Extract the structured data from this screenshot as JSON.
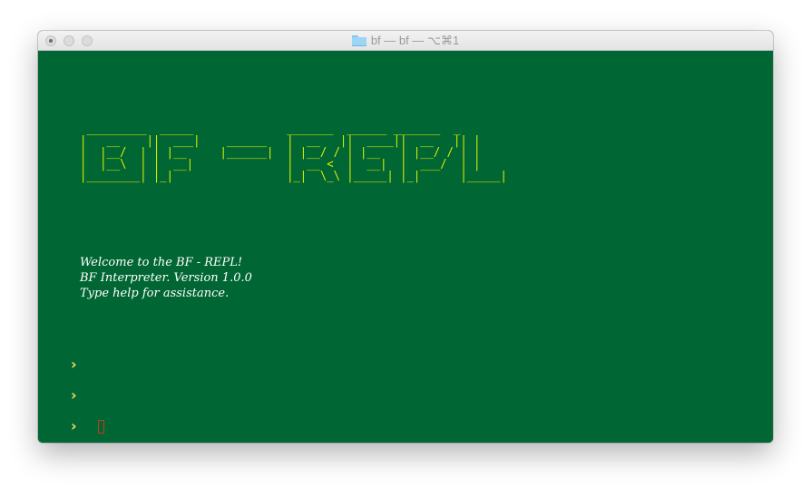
{
  "window": {
    "title": "bf — bf — ⌥⌘1",
    "title_icon": "folder-icon",
    "background_color": "#006633"
  },
  "banner": {
    "ascii_art": " _________  _____              _______  ______ _______  _\n|   __    ||  ___|    ______   |  __   ||  ____||  __   || |\n|  |__/  | | |__     |______|  | |__/ / | |__   | |__/ / | |\n|  |__\\  | |  __|              |  __ <  |  __|  |  ___/  | |\n|________| |_|                 |_|  \\_\\ |_____| |_|      |_____|",
    "text": "BF - REPL",
    "color": "#d9ef00"
  },
  "welcome": {
    "line1": "Welcome to the BF - REPL!",
    "line2": "BF Interpreter. Version 1.0.0",
    "line3": "Type help for assistance."
  },
  "prompts": [
    {
      "symbol": "›"
    },
    {
      "symbol": "›"
    },
    {
      "symbol": "›"
    }
  ],
  "colors": {
    "prompt": "#f0e060",
    "cursor": "#c83a1e",
    "text": "#ffffff"
  }
}
